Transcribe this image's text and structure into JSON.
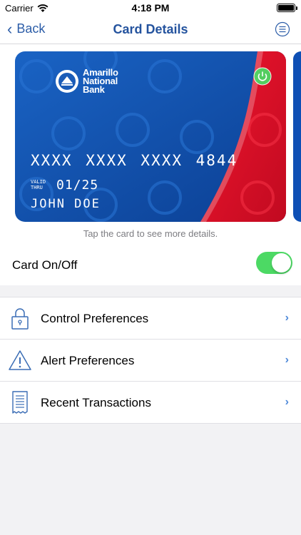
{
  "status_bar": {
    "carrier": "Carrier",
    "time": "4:18 PM"
  },
  "nav": {
    "back_label": "Back",
    "title": "Card Details"
  },
  "card": {
    "bank_name_line1": "Amarillo",
    "bank_name_line2": "National",
    "bank_name_line3": "Bank",
    "number": "XXXX XXXX XXXX 4844",
    "valid_line1": "VALID",
    "valid_line2": "THRU",
    "expiry": "01/25",
    "holder": "JOHN DOE"
  },
  "tap_hint": "Tap the card to see more details.",
  "toggle": {
    "label": "Card On/Off",
    "on": true
  },
  "list": [
    {
      "label": "Control Preferences",
      "icon": "lock-icon"
    },
    {
      "label": "Alert Preferences",
      "icon": "warning-icon"
    },
    {
      "label": "Recent Transactions",
      "icon": "receipt-icon"
    }
  ],
  "colors": {
    "accent": "#2c5da8",
    "switch_on": "#4cd964",
    "card_blue": "#0f4fa8",
    "card_red": "#e8102a"
  }
}
